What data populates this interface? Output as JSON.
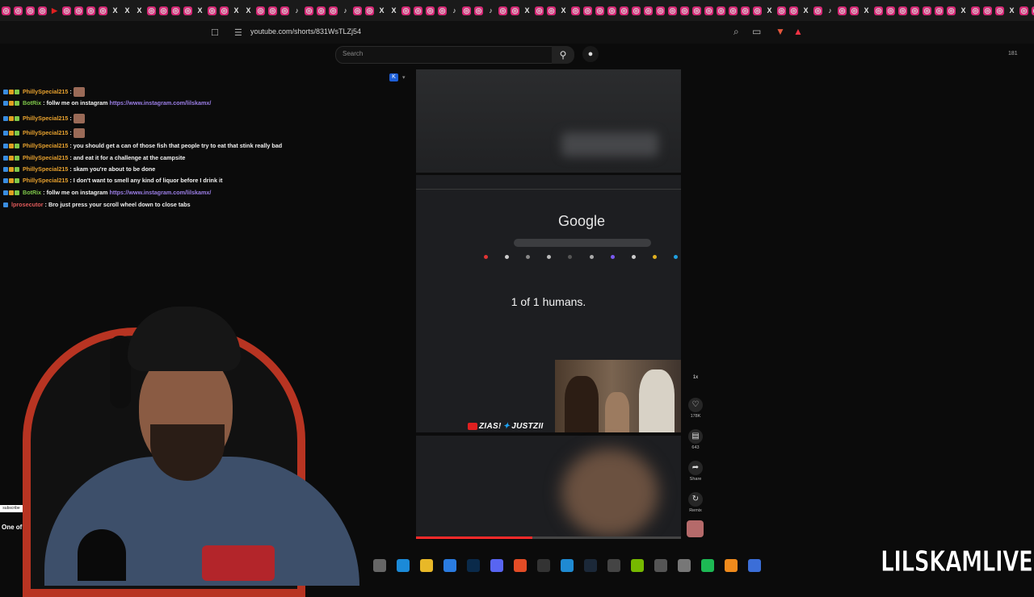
{
  "browser": {
    "url": "youtube.com/shorts/831WsTLZj54",
    "tab_favicons": [
      "ig",
      "ig",
      "ig",
      "ig",
      "yt",
      "ig",
      "ig",
      "ig",
      "ig",
      "x",
      "x",
      "x",
      "ig",
      "ig",
      "ig",
      "ig",
      "x",
      "ig",
      "ig",
      "x",
      "x",
      "ig",
      "ig",
      "ig",
      "tt",
      "ig",
      "ig",
      "ig",
      "tt",
      "ig",
      "ig",
      "x",
      "x",
      "ig",
      "ig",
      "ig",
      "ig",
      "tt",
      "ig",
      "ig",
      "tt",
      "ig",
      "ig",
      "x",
      "ig",
      "ig",
      "x",
      "ig",
      "ig",
      "ig",
      "ig",
      "ig",
      "ig",
      "ig",
      "ig",
      "ig",
      "ig",
      "ig",
      "ig",
      "ig",
      "ig",
      "ig",
      "ig",
      "x",
      "ig",
      "ig",
      "x",
      "ig",
      "tt",
      "ig",
      "ig",
      "x",
      "ig",
      "ig",
      "ig",
      "ig",
      "ig",
      "ig",
      "ig",
      "x",
      "ig",
      "ig",
      "ig",
      "x",
      "ig",
      "ig",
      "x",
      "ig",
      "ig",
      "ig",
      "tt",
      "ig",
      "ig",
      "ig",
      "ig",
      "x",
      "ig",
      "ig",
      "x",
      "ig",
      "ig",
      "ig",
      "ig",
      "ig",
      "ig",
      "x",
      "ig",
      "tt",
      "ig",
      "ig",
      "x",
      "ig",
      "ig",
      "ig",
      "ig",
      "ig",
      "ig",
      "yt",
      "ig",
      "ig",
      "x",
      "tt",
      "ig",
      "x"
    ]
  },
  "youtube": {
    "search_placeholder": "Search",
    "viewer_count": "181",
    "short": {
      "google_logo": "Google",
      "caption": "1 of 1 humans.",
      "watermark": "ZIAS!",
      "watermark2": "JUSTZII",
      "progress": 0.44
    },
    "actions": [
      {
        "icon": "speed-icon",
        "label": "1x"
      },
      {
        "icon": "like-icon",
        "label": "178K"
      },
      {
        "icon": "comment-icon",
        "label": "643"
      },
      {
        "icon": "share-icon",
        "label": "Share"
      },
      {
        "icon": "remix-icon",
        "label": "Remix"
      }
    ]
  },
  "chat": {
    "messages": [
      {
        "user": "PhillySpecial215",
        "type": "user",
        "text": "",
        "emote": true
      },
      {
        "user": "BotRix",
        "type": "bot",
        "text": "follw me on instagram",
        "link": "https://www.instagram.com/lilskamx/"
      },
      {
        "user": "PhillySpecial215",
        "type": "user",
        "text": "",
        "emote": true
      },
      {
        "user": "PhillySpecial215",
        "type": "user",
        "text": "",
        "emote": true
      },
      {
        "user": "PhillySpecial215",
        "type": "user",
        "text": "you should get a can of those fish that people try to eat that stink really bad"
      },
      {
        "user": "PhillySpecial215",
        "type": "user",
        "text": "and eat it for a challenge at the campsite"
      },
      {
        "user": "PhillySpecial215",
        "type": "user",
        "text": "skam you're about to be done"
      },
      {
        "user": "PhillySpecial215",
        "type": "user",
        "text": "I don't want to smell any kind of liquor before I drink it"
      },
      {
        "user": "BotRix",
        "type": "bot",
        "text": "follw me on instagram",
        "link": "https://www.instagram.com/lilskamx/"
      },
      {
        "user": "lprosecutor",
        "type": "pro",
        "text": "Bro just press your scroll wheel down to close tabs"
      }
    ]
  },
  "overlay": {
    "subscribe_sticker": "subscribe",
    "goal_text": "One of",
    "brand": "LILSKAMLIVE"
  },
  "taskbar": [
    "settings",
    "edge",
    "folder",
    "store",
    "photoshop",
    "discord",
    "brave",
    "obs",
    "vscode",
    "steam",
    "epic",
    "nvidia",
    "4k",
    "calc",
    "spotify",
    "fl",
    "app"
  ],
  "colors": {
    "accent": "#ff2a2a",
    "username": "#e7a12e",
    "bot": "#7fc84a",
    "link": "#9b7ee6"
  }
}
